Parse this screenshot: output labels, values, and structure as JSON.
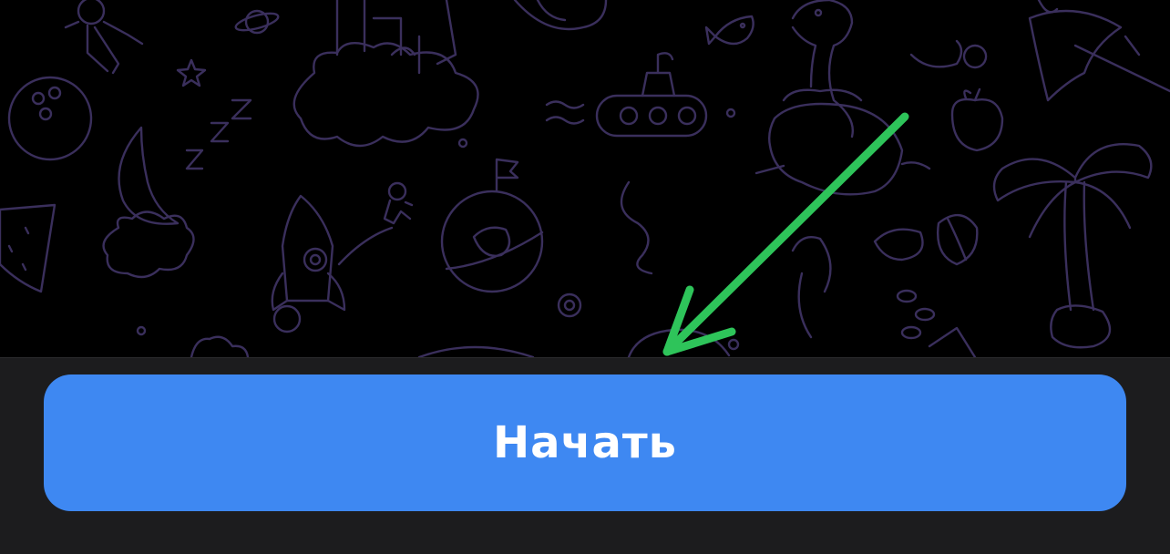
{
  "wallpaper": {
    "background_color": "#000000",
    "doodle_color": "#3a2f5c",
    "doodle_icons": [
      "gingerbread-icon",
      "planet-icon",
      "castle-icon",
      "turtle-icon",
      "fish-icon",
      "dinosaur-icon",
      "umbrella-icon",
      "star-icon",
      "moon-icon",
      "sleep-zzz-icon",
      "submarine-icon",
      "apple-icon",
      "palm-tree-icon",
      "watermelon-icon",
      "rocket-icon",
      "astronaut-icon",
      "globe-flag-icon",
      "orange-icon",
      "whale-icon",
      "cloud-icon",
      "coins-icon"
    ]
  },
  "annotation": {
    "arrow_color": "#2ec45a",
    "arrow_icon": "arrow-down-left-icon"
  },
  "bottom_bar": {
    "background_color": "#1c1c1e",
    "start_button": {
      "label": "Начать",
      "color": "#3e88f2",
      "text_color": "#ffffff"
    }
  }
}
